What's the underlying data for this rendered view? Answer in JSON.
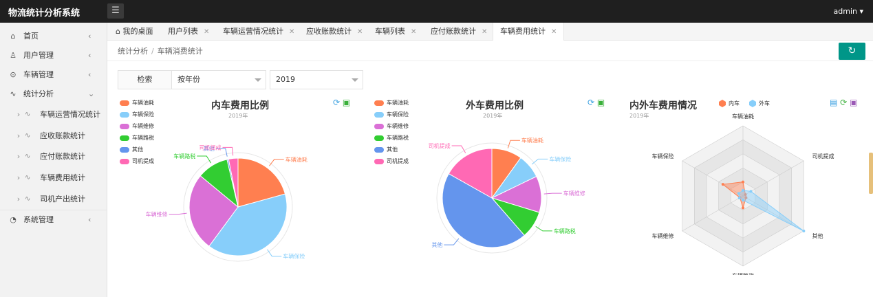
{
  "app": {
    "title": "物流统计分析系统",
    "user": "admin"
  },
  "sidebar": {
    "items": [
      {
        "icon": "home-icon",
        "label": "首页"
      },
      {
        "icon": "user-icon",
        "label": "用户管理"
      },
      {
        "icon": "vehicle-icon",
        "label": "车辆管理"
      },
      {
        "icon": "chart-icon",
        "label": "统计分析"
      },
      {
        "icon": "pulse-icon",
        "label": "车辆运营情况统计"
      },
      {
        "icon": "pulse-icon",
        "label": "应收账款统计"
      },
      {
        "icon": "pulse-icon",
        "label": "应付账款统计"
      },
      {
        "icon": "pulse-icon",
        "label": "车辆费用统计"
      },
      {
        "icon": "pulse-icon",
        "label": "司机产出统计"
      },
      {
        "icon": "settings-icon",
        "label": "系统管理"
      }
    ]
  },
  "tabs": [
    {
      "label": "我的桌面"
    },
    {
      "label": "用户列表"
    },
    {
      "label": "车辆运营情况统计"
    },
    {
      "label": "应收账款统计"
    },
    {
      "label": "车辆列表"
    },
    {
      "label": "应付账款统计"
    },
    {
      "label": "车辆费用统计"
    }
  ],
  "breadcrumb": {
    "parent": "统计分析",
    "current": "车辆消费统计"
  },
  "filter": {
    "label": "检索",
    "mode": "按年份",
    "year": "2019"
  },
  "colors": {
    "accent": "#009688",
    "topbar": "#1f1f1f"
  },
  "chart_data": [
    {
      "type": "pie",
      "title": "内车费用比例",
      "subtitle": "2019年",
      "legend": [
        "车辆油耗",
        "车辆保险",
        "车辆维修",
        "车辆路税",
        "其他",
        "司机提成"
      ],
      "colors": [
        "#ff7f50",
        "#87cefa",
        "#da70d6",
        "#32cd32",
        "#6495ed",
        "#ff69b4"
      ],
      "values": [
        20,
        38,
        25,
        10,
        0.5,
        3
      ]
    },
    {
      "type": "pie",
      "title": "外车费用比例",
      "subtitle": "2019年",
      "legend": [
        "车辆油耗",
        "车辆保险",
        "车辆维修",
        "车辆路税",
        "其他",
        "司机提成"
      ],
      "colors": [
        "#ff7f50",
        "#87cefa",
        "#da70d6",
        "#32cd32",
        "#6495ed",
        "#ff69b4"
      ],
      "values": [
        10,
        8,
        12,
        9,
        45,
        17
      ]
    },
    {
      "type": "radar",
      "title": "内外车费用情况",
      "subtitle": "2019年",
      "indicators": [
        "车辆油耗",
        "司机提成",
        "其他",
        "车辆路税",
        "车辆维修",
        "车辆保险"
      ],
      "series": [
        {
          "name": "内车",
          "color": "#ff7f50",
          "values": [
            0.2,
            0.04,
            0.05,
            0.17,
            0.05,
            0.33
          ]
        },
        {
          "name": "外车",
          "color": "#87cefa",
          "values": [
            0.08,
            0.13,
            1.0,
            0.06,
            0.06,
            0.07
          ]
        }
      ]
    }
  ]
}
